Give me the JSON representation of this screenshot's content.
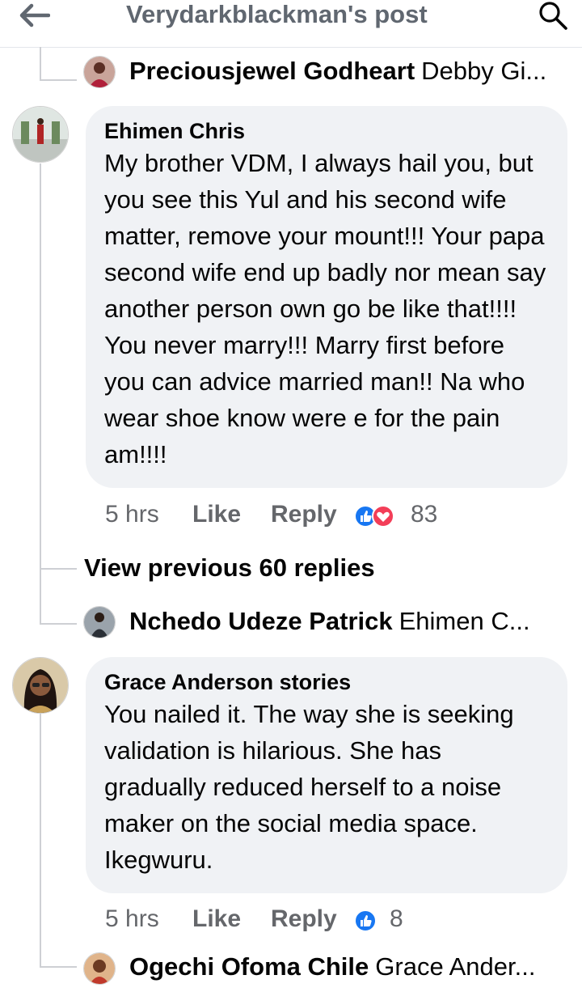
{
  "header": {
    "title": "Verydarkblackman's post"
  },
  "thread": [
    {
      "type": "reply_preview",
      "name": "Preciousjewel Godheart",
      "text": "Debby Gi..."
    },
    {
      "type": "comment",
      "author": "Ehimen Chris",
      "body": "My brother VDM, I always hail you, but you see this Yul and his second wife matter, remove your mount!!! Your  papa second wife end up badly nor mean say another person own go be like that!!!! You never marry!!! Marry first before you can advice married man!! Na who wear shoe know were e for the pain am!!!!",
      "time": "5 hrs",
      "like": "Like",
      "reply": "Reply",
      "reactions": [
        "like",
        "love"
      ],
      "reaction_count": "83"
    },
    {
      "type": "view_previous",
      "label": "View previous 60 replies"
    },
    {
      "type": "reply_preview",
      "name": "Nchedo Udeze Patrick",
      "text": "Ehimen C..."
    },
    {
      "type": "comment",
      "author": "Grace Anderson stories",
      "body": "You nailed it. The way she is seeking validation is hilarious. She has gradually reduced herself to a noise maker on the social media space. Ikegwuru.",
      "time": "5 hrs",
      "like": "Like",
      "reply": "Reply",
      "reactions": [
        "like"
      ],
      "reaction_count": "8"
    },
    {
      "type": "reply_preview",
      "name": "Ogechi Ofoma Chile",
      "text": "Grace Ander..."
    }
  ],
  "colors": {
    "like_blue": "#1877f2",
    "love_red": "#f33e58",
    "bubble_bg": "#f0f2f5",
    "meta_gray": "#65676b"
  }
}
